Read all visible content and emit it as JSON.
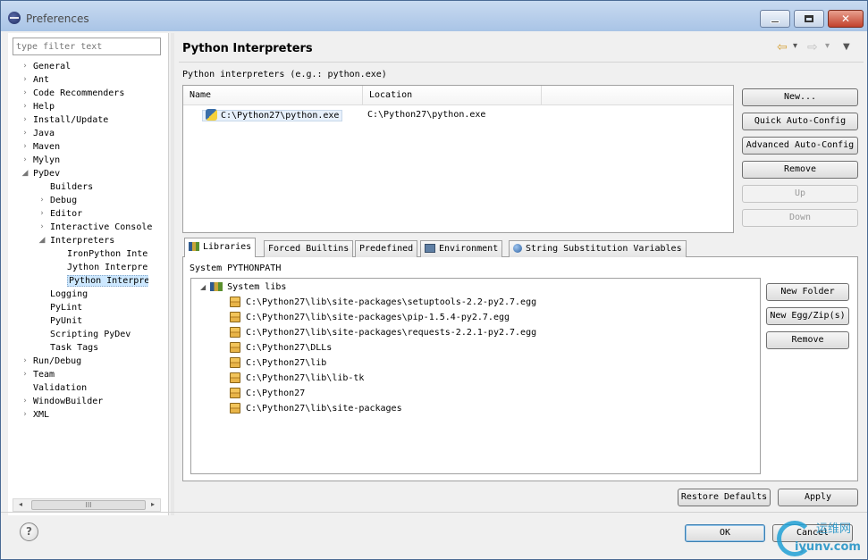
{
  "window": {
    "title": "Preferences",
    "close_glyph": "✕"
  },
  "filter": {
    "placeholder": "type filter text"
  },
  "tree": [
    {
      "label": "General",
      "arrow": "›"
    },
    {
      "label": "Ant",
      "arrow": "›"
    },
    {
      "label": "Code Recommenders",
      "arrow": "›"
    },
    {
      "label": "Help",
      "arrow": "›"
    },
    {
      "label": "Install/Update",
      "arrow": "›"
    },
    {
      "label": "Java",
      "arrow": "›"
    },
    {
      "label": "Maven",
      "arrow": "›"
    },
    {
      "label": "Mylyn",
      "arrow": "›"
    },
    {
      "label": "PyDev",
      "arrow": "◢"
    },
    {
      "label": "Builders",
      "arrow": ""
    },
    {
      "label": "Debug",
      "arrow": "›"
    },
    {
      "label": "Editor",
      "arrow": "›"
    },
    {
      "label": "Interactive Console",
      "arrow": "›"
    },
    {
      "label": "Interpreters",
      "arrow": "◢"
    },
    {
      "label": "IronPython Interpre",
      "arrow": ""
    },
    {
      "label": "Jython Interpreter",
      "arrow": ""
    },
    {
      "label": "Python Interpreter",
      "arrow": ""
    },
    {
      "label": "Logging",
      "arrow": ""
    },
    {
      "label": "PyLint",
      "arrow": ""
    },
    {
      "label": "PyUnit",
      "arrow": ""
    },
    {
      "label": "Scripting PyDev",
      "arrow": ""
    },
    {
      "label": "Task Tags",
      "arrow": ""
    },
    {
      "label": "Run/Debug",
      "arrow": "›"
    },
    {
      "label": "Team",
      "arrow": "›"
    },
    {
      "label": "Validation",
      "arrow": ""
    },
    {
      "label": "WindowBuilder",
      "arrow": "›"
    },
    {
      "label": "XML",
      "arrow": "›"
    }
  ],
  "hscroll": {
    "left": "◂",
    "right": "▸",
    "grip": "III"
  },
  "page": {
    "title": "Python Interpreters",
    "nav": {
      "back": "⇦",
      "back_menu": "▾",
      "fwd": "⇨",
      "fwd_menu": "▾",
      "menu": "▼"
    },
    "section_label": "Python interpreters (e.g.: python.exe)",
    "table": {
      "headers": [
        "Name",
        "Location"
      ],
      "rows": [
        {
          "name": "C:\\Python27\\python.exe",
          "location": "C:\\Python27\\python.exe"
        }
      ]
    },
    "buttons": {
      "new": "New...",
      "quick": "Quick Auto-Config",
      "advanced": "Advanced Auto-Config",
      "remove": "Remove",
      "up": "Up",
      "down": "Down"
    },
    "tabs": [
      "Libraries",
      "Forced Builtins",
      "Predefined",
      "Environment",
      "String Substitution Variables"
    ],
    "syspath_label": "System PYTHONPATH",
    "syslibs": {
      "root": "System libs",
      "expander": "◢",
      "items": [
        "C:\\Python27\\lib\\site-packages\\setuptools-2.2-py2.7.egg",
        "C:\\Python27\\lib\\site-packages\\pip-1.5.4-py2.7.egg",
        "C:\\Python27\\lib\\site-packages\\requests-2.2.1-py2.7.egg",
        "C:\\Python27\\DLLs",
        "C:\\Python27\\lib",
        "C:\\Python27\\lib\\lib-tk",
        "C:\\Python27",
        "C:\\Python27\\lib\\site-packages"
      ]
    },
    "lib_buttons": {
      "new_folder": "New Folder",
      "new_egg": "New Egg/Zip(s)",
      "remove": "Remove"
    },
    "restore": "Restore Defaults",
    "apply": "Apply"
  },
  "footer": {
    "help": "?",
    "ok": "OK",
    "cancel": "Cancel"
  },
  "watermark": {
    "cn": "运维网",
    "en": "iyunv.com"
  }
}
